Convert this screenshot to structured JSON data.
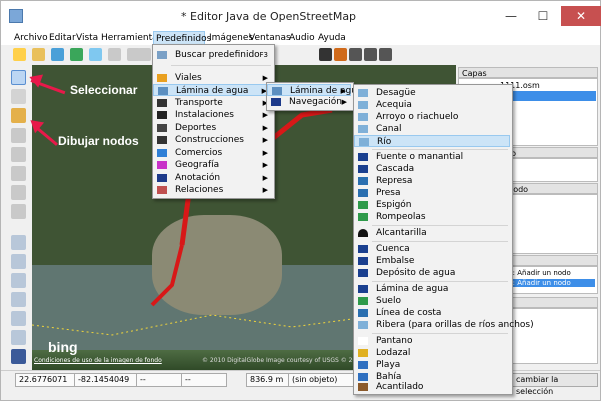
{
  "window": {
    "title": "* Editor Java de OpenStreetMap",
    "minimize": "—",
    "maximize": "☐",
    "close": "✕"
  },
  "menubar": [
    "Archivo",
    "Editar",
    "Vista",
    "Herramientas",
    "Predefinidos",
    "Imágenes",
    "Ventanas",
    "Audio",
    "Ayuda"
  ],
  "map": {
    "bing": "bing",
    "terms": "Condiciones de uso de la imagen de fondo",
    "copyright": "© 2010 DigitalGlobe Image courtesy of USGS © 2010"
  },
  "annotations": {
    "select": "Seleccionar",
    "draw": "Dibujar nodos"
  },
  "menu_predefinidos": {
    "search": {
      "label": "Buscar predefinido",
      "shortcut": "F3"
    },
    "items": [
      "Viales",
      "Lámina de agua",
      "Transporte",
      "Instalaciones",
      "Deportes",
      "Construcciones",
      "Comercios",
      "Geografía",
      "Anotación",
      "Relaciones"
    ]
  },
  "menu_lamina": {
    "items": [
      "Lámina de agua",
      "Navegación"
    ]
  },
  "menu_water": {
    "group1": [
      "Desagüe",
      "Acequia",
      "Arroyo o riachuelo",
      "Canal",
      "Río"
    ],
    "group2": [
      "Fuente o manantial",
      "Cascada",
      "Represa",
      "Presa",
      "Espigón",
      "Rompeolas"
    ],
    "group3": [
      "Alcantarilla"
    ],
    "group4": [
      "Cuenca",
      "Embalse",
      "Depósito de agua"
    ],
    "group5": [
      "Lámina de agua",
      "Suelo",
      "Línea de costa",
      "Ribera (para orillas de ríos anchos)"
    ],
    "group6": [
      "Pantano",
      "Lodazal",
      "Playa",
      "Bahía",
      "Acantilado"
    ]
  },
  "panels": {
    "layers": {
      "title": "Capas",
      "file": "1111.osm",
      "sel": "t"
    },
    "p2": {
      "title": "les / Miembro"
    },
    "p3": {
      "title": "0 / Vías:1 / Nodo"
    },
    "p4": {
      "title": "mandos",
      "line1": "s: Añadir un nodo",
      "line2": "s: Añadir un nodo"
    },
    "p5": {
      "title": "s de la vía"
    },
    "button": "cambiar la selección"
  },
  "statusbar": {
    "lat": "22.6776071",
    "lon": "-82.1454049",
    "angle": "--",
    "heading": "--",
    "dist": "836.9 m",
    "obj": "(sin objeto)"
  },
  "colors": {
    "highlight": "#cce4f7",
    "annotation": "#e8194a",
    "selected_way": "#d81818"
  }
}
